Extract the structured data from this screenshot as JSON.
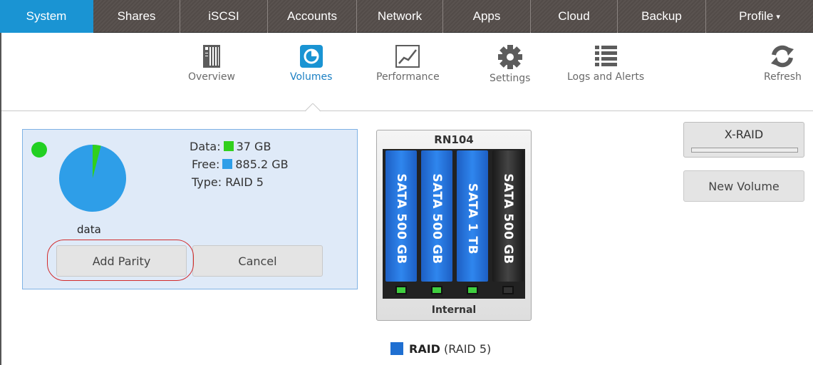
{
  "nav": {
    "tabs": [
      {
        "label": "System",
        "active": true
      },
      {
        "label": "Shares"
      },
      {
        "label": "iSCSI"
      },
      {
        "label": "Accounts"
      },
      {
        "label": "Network"
      },
      {
        "label": "Apps"
      },
      {
        "label": "Cloud"
      },
      {
        "label": "Backup"
      },
      {
        "label": "Profile"
      }
    ],
    "profile_caret": "▾",
    "active_color": "#1a94d3"
  },
  "subnav": {
    "overview": "Overview",
    "volumes": "Volumes",
    "performance": "Performance",
    "settings": "Settings",
    "logs": "Logs and Alerts",
    "refresh": "Refresh"
  },
  "volume": {
    "name": "data",
    "status_color": "#22d022",
    "data_label": "Data:",
    "data_value": "37 GB",
    "data_color": "#31d01c",
    "free_label": "Free:",
    "free_value": "885.2 GB",
    "free_color": "#2e9ee8",
    "type_label": "Type:",
    "type_value": "RAID 5",
    "used_fraction": 0.04
  },
  "actions": {
    "add_parity": "Add Parity",
    "cancel": "Cancel"
  },
  "chassis": {
    "model": "RN104",
    "location": "Internal",
    "disks": [
      {
        "label": "SATA 500 GB",
        "color": "blue"
      },
      {
        "label": "SATA 500 GB",
        "color": "blue"
      },
      {
        "label": "SATA 1 TB",
        "color": "blue"
      },
      {
        "label": "SATA 500 GB",
        "color": "black"
      }
    ]
  },
  "right": {
    "xraid": "X-RAID",
    "new_volume": "New Volume"
  },
  "legend": {
    "name": "RAID",
    "detail": "(RAID 5)",
    "color": "#1f6fd1"
  }
}
